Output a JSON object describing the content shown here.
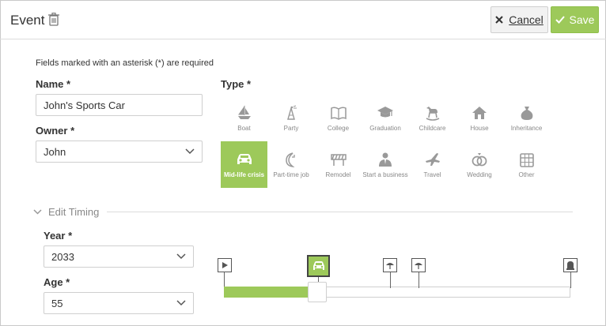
{
  "header": {
    "title": "Event",
    "cancel_label": "Cancel",
    "save_label": "Save",
    "accent": "#9dc95a"
  },
  "form": {
    "required_note": "Fields marked with an asterisk (*) are required",
    "name_label": "Name *",
    "name_value": "John's Sports Car",
    "owner_label": "Owner *",
    "owner_value": "John",
    "type_label": "Type *"
  },
  "types": [
    {
      "label": "Boat",
      "icon": "boat-icon"
    },
    {
      "label": "Party",
      "icon": "party-hat-icon"
    },
    {
      "label": "College",
      "icon": "book-icon"
    },
    {
      "label": "Graduation",
      "icon": "graduation-cap-icon"
    },
    {
      "label": "Childcare",
      "icon": "rocking-horse-icon"
    },
    {
      "label": "House",
      "icon": "house-icon"
    },
    {
      "label": "Inheritance",
      "icon": "money-bag-icon"
    },
    {
      "label": "Mid-life crisis",
      "icon": "car-icon",
      "selected": true
    },
    {
      "label": "Part-time job",
      "icon": "moon-clock-icon"
    },
    {
      "label": "Remodel",
      "icon": "barrier-icon"
    },
    {
      "label": "Start a business",
      "icon": "businessman-icon"
    },
    {
      "label": "Travel",
      "icon": "airplane-icon"
    },
    {
      "label": "Wedding",
      "icon": "rings-icon"
    },
    {
      "label": "Other",
      "icon": "calendar-icon"
    }
  ],
  "timing": {
    "section_label": "Edit Timing",
    "year_label": "Year *",
    "year_value": "2033",
    "age_label": "Age *",
    "age_value": "55",
    "timeline_progress": 0.25
  }
}
